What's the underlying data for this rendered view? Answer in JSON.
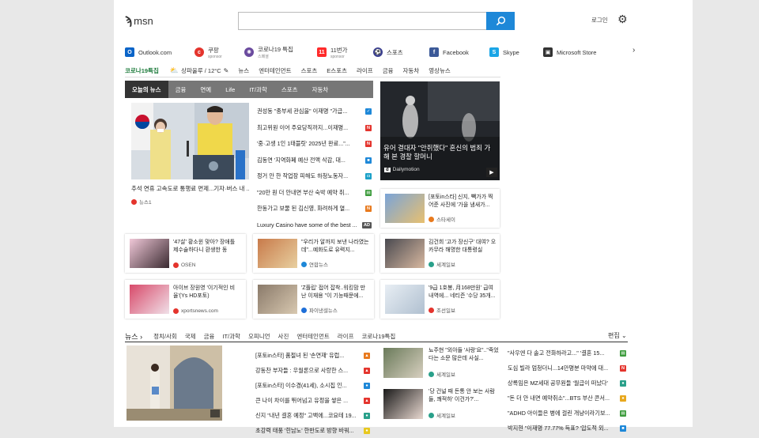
{
  "header": {
    "logo": "msn",
    "search_placeholder": "",
    "login": "로그인"
  },
  "quicklinks": [
    {
      "label": "Outlook.com",
      "sub": "",
      "color": "#0a64c8",
      "icon": "outlook-icon",
      "glyph": "O"
    },
    {
      "label": "쿠팡",
      "sub": "sponsor",
      "color": "#e4342d",
      "icon": "coupang-icon",
      "glyph": "c"
    },
    {
      "label": "코로나19 특집",
      "sub": "스페셜",
      "color": "#6a4a9e",
      "icon": "virus-icon",
      "glyph": "✺"
    },
    {
      "label": "11번가",
      "sub": "sponsor",
      "color": "#ff2a2a",
      "icon": "11st-icon",
      "glyph": "11"
    },
    {
      "label": "스포츠",
      "sub": "",
      "color": "#3a3f8f",
      "icon": "sports-icon",
      "glyph": "⚽"
    },
    {
      "label": "Facebook",
      "sub": "",
      "color": "#3b5998",
      "icon": "facebook-icon",
      "glyph": "f"
    },
    {
      "label": "Skype",
      "sub": "",
      "color": "#1aa5e6",
      "icon": "skype-icon",
      "glyph": "S"
    },
    {
      "label": "Microsoft Store",
      "sub": "",
      "color": "#333333",
      "icon": "store-icon",
      "glyph": "▣"
    }
  ],
  "topnav": {
    "covid": "코로나19특집",
    "weather": "상파울루 / 12°C",
    "items": [
      "뉴스",
      "엔터테인먼트",
      "스포츠",
      "E스포츠",
      "라이프",
      "금융",
      "자동차",
      "영상뉴스"
    ]
  },
  "tabs": [
    "오늘의 뉴스",
    "금융",
    "연예",
    "Life",
    "IT/과학",
    "스포츠",
    "자동차"
  ],
  "hero": {
    "caption": "추석 연휴 고속도로 통행료 면제...기자·버스 내 ...",
    "source": "뉴스1"
  },
  "headlines": [
    {
      "title": "권성동 \"종부세 관심을\" 이재명 \"가급...",
      "badge_color": "#1e88d8",
      "badge": "✓"
    },
    {
      "title": "최고위원 이어 주요당직까지...이재명...",
      "badge_color": "#e4342d",
      "badge": "N"
    },
    {
      "title": "'중·고생 1인 1태블릿' 2025년 완료...\"...",
      "badge_color": "#e4342d",
      "badge": "N"
    },
    {
      "title": "김동연 '지역화폐 예산 전액 삭감, 대...",
      "badge_color": "#1e88d8",
      "badge": "■"
    },
    {
      "title": "정거 안 한 작업장 피해도 하청노동자...",
      "badge_color": "#1aa0c8",
      "badge": "◘"
    },
    {
      "title": "\"20만 원 더 안내면 부산 숙박 예약 취...",
      "badge_color": "#3c9b3c",
      "badge": "▤"
    },
    {
      "title": "한동가고 보물 된 김신영, 화려하게 열...",
      "badge_color": "#e87a1e",
      "badge": "N"
    },
    {
      "title": "Luxury Casino have some of the best ...",
      "badge_color": "#555555",
      "badge": "AD"
    }
  ],
  "video": {
    "title": "유어 결대자 \"안쥐했다\" 혼신의 범죄 가해 본 경찰 할머니",
    "source": "Dailymotion"
  },
  "cards": [
    {
      "title": "[포토in스타] 신지, 빽가가 찍어준 사진에 '가을 냄새가...",
      "source": "스타세이",
      "color": "#e87a1e"
    },
    {
      "title": "'47살' 황소윈 맞아? 장애틀 제수술하다니 환생한 동",
      "source": "OSEN",
      "color": "#e4342d"
    },
    {
      "title": "\"우리가 알까지 보낸 나라였는데\"...예화도로 유력지...",
      "source": "연합뉴스",
      "color": "#1e88d8"
    },
    {
      "title": "김건희 '고가 장신구' 대여? 오카무라 해명한 대통령실",
      "source": "세계일보",
      "color": "#2aa08a"
    },
    {
      "title": "아이브 장원영 '이기적인 비율'(Ys HD포토)",
      "source": "xportsnews.com",
      "color": "#e4342d"
    },
    {
      "title": "'Z플립' 접어 잡착..워킹맘 만난 이재용 \"이 기능때문에...",
      "source": "파이낸셜뉴스",
      "color": "#1e6fd8"
    },
    {
      "title": "'9급 1호봉, 月168만원' 급여 내역에... 네티즌 '수당 35개...",
      "source": "조선일보",
      "color": "#e4342d"
    }
  ],
  "news_section": {
    "heading": "뉴스",
    "items": [
      "정치/사회",
      "국제",
      "금융",
      "IT/과학",
      "오피니언",
      "사진",
      "엔터테인먼트",
      "라이프",
      "코로나19특집"
    ],
    "edit": "편집"
  },
  "bottom_list": [
    {
      "title": "[포토in스타] 품절녀 된 '손연재' 유럽...",
      "badge_color": "#e87a1e",
      "badge": "▲"
    },
    {
      "title": "강동찬 부자들 : 우월론으로 사랑한 스...",
      "badge_color": "#e4342d",
      "badge": "▲"
    },
    {
      "title": "[포토in스타] 이수경(41세), 소시집 인...",
      "badge_color": "#1e88d8",
      "badge": "●"
    },
    {
      "title": "큰 나이 차이를 뛰어넘고 유정을 쌓은 ...",
      "badge_color": "#e4342d",
      "badge": "▲"
    },
    {
      "title": "신지 \"내년 결혼 예정\" 고백에...코요테 19...",
      "badge_color": "#2aa08a",
      "badge": "●"
    },
    {
      "title": "초강력 태풍 '힌남노' 한반도로 방향 바꿔...",
      "badge_color": "#e8c81e",
      "badge": "●"
    }
  ],
  "mid_cards": [
    {
      "title": "뇨주현 \"외아들 '사랑'요\"..\"죽었다는 소문 많은데 사실...",
      "source": "세계일보"
    },
    {
      "title": "'당 건널 때 돈통 안 보는 사람들, 쾌적하' 이건가?'...",
      "source": "세계일보"
    }
  ],
  "right_list": [
    {
      "title": "\"사우엔 다 솔고 전화하라고...\" '결혼 15...",
      "badge_color": "#3c9b3c",
      "badge": "▤"
    },
    {
      "title": "도심 빌라 엄청더니...14만명분 마약에 대...",
      "badge_color": "#e4342d",
      "badge": "N"
    },
    {
      "title": "상록임은 MZ세대 공무원들 '월급이 떠났다'",
      "badge_color": "#2aa08a",
      "badge": "●"
    },
    {
      "title": "\"돈 더 안 내면 예약취소\"...BTS 부산 콘서...",
      "badge_color": "#e8a81e",
      "badge": "●"
    },
    {
      "title": "\"ADHD 아이들은 병에 걸린 개냥이라기보...",
      "badge_color": "#3c9b3c",
      "badge": "▤"
    },
    {
      "title": "박지현 \"이재명 77.77% 득표? '압도적 외...",
      "badge_color": "#1e88d8",
      "badge": "■"
    }
  ]
}
